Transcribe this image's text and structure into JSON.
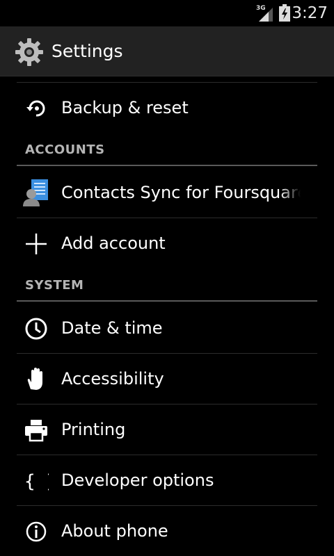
{
  "status_bar": {
    "network": "3G",
    "time": "3:27"
  },
  "action_bar": {
    "title": "Settings",
    "icon": "gear-icon"
  },
  "list": {
    "items_top": [
      {
        "label": "Backup & reset",
        "icon": "backup-restore-icon"
      }
    ],
    "sections": [
      {
        "header": "ACCOUNTS",
        "items": [
          {
            "label": "Contacts Sync for Foursquare",
            "icon": "contacts-sync-icon"
          },
          {
            "label": "Add account",
            "icon": "plus-icon"
          }
        ]
      },
      {
        "header": "SYSTEM",
        "items": [
          {
            "label": "Date & time",
            "icon": "clock-icon"
          },
          {
            "label": "Accessibility",
            "icon": "hand-icon"
          },
          {
            "label": "Printing",
            "icon": "printer-icon"
          },
          {
            "label": "Developer options",
            "icon": "braces-icon"
          },
          {
            "label": "About phone",
            "icon": "info-icon"
          }
        ]
      }
    ]
  },
  "colors": {
    "background": "#000000",
    "action_bar": "#222222",
    "text_primary": "#ffffff",
    "section_header": "#b5b5b5"
  }
}
